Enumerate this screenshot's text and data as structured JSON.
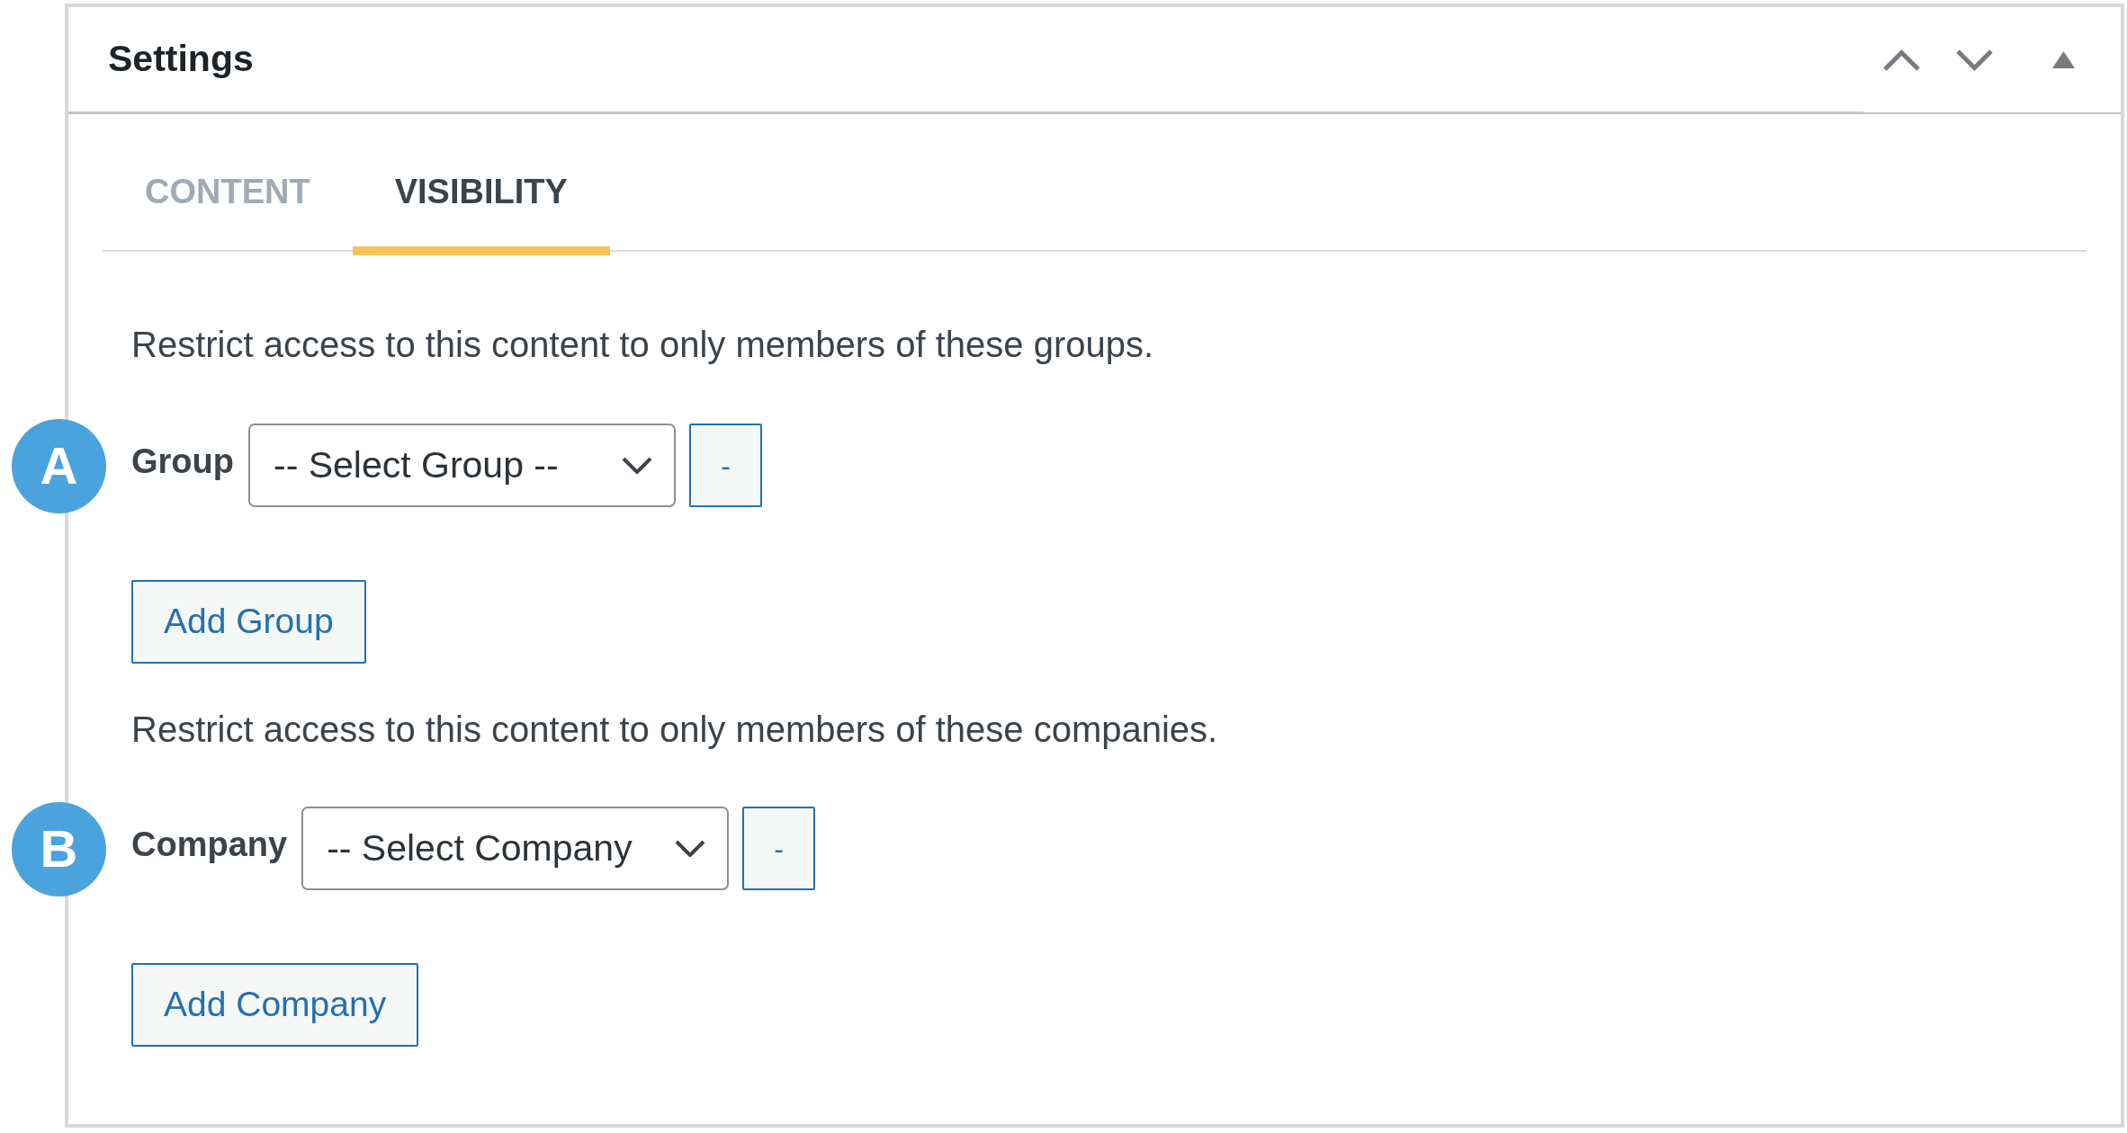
{
  "panel": {
    "title": "Settings"
  },
  "tabs": [
    {
      "label": "CONTENT",
      "selected": false
    },
    {
      "label": "VISIBILITY",
      "selected": true
    }
  ],
  "sections": [
    {
      "description": "Restrict access to this content to only members of these groups.",
      "marker": "A",
      "field_label": "Group",
      "select": {
        "value": "-- Select Group --"
      },
      "remove_button": "-",
      "add_button": "Add Group"
    },
    {
      "description": "Restrict access to this content to only members of these companies.",
      "marker": "B",
      "field_label": "Company",
      "select": {
        "value": "-- Select Company"
      },
      "remove_button": "-",
      "add_button": "Add Company"
    }
  ]
}
